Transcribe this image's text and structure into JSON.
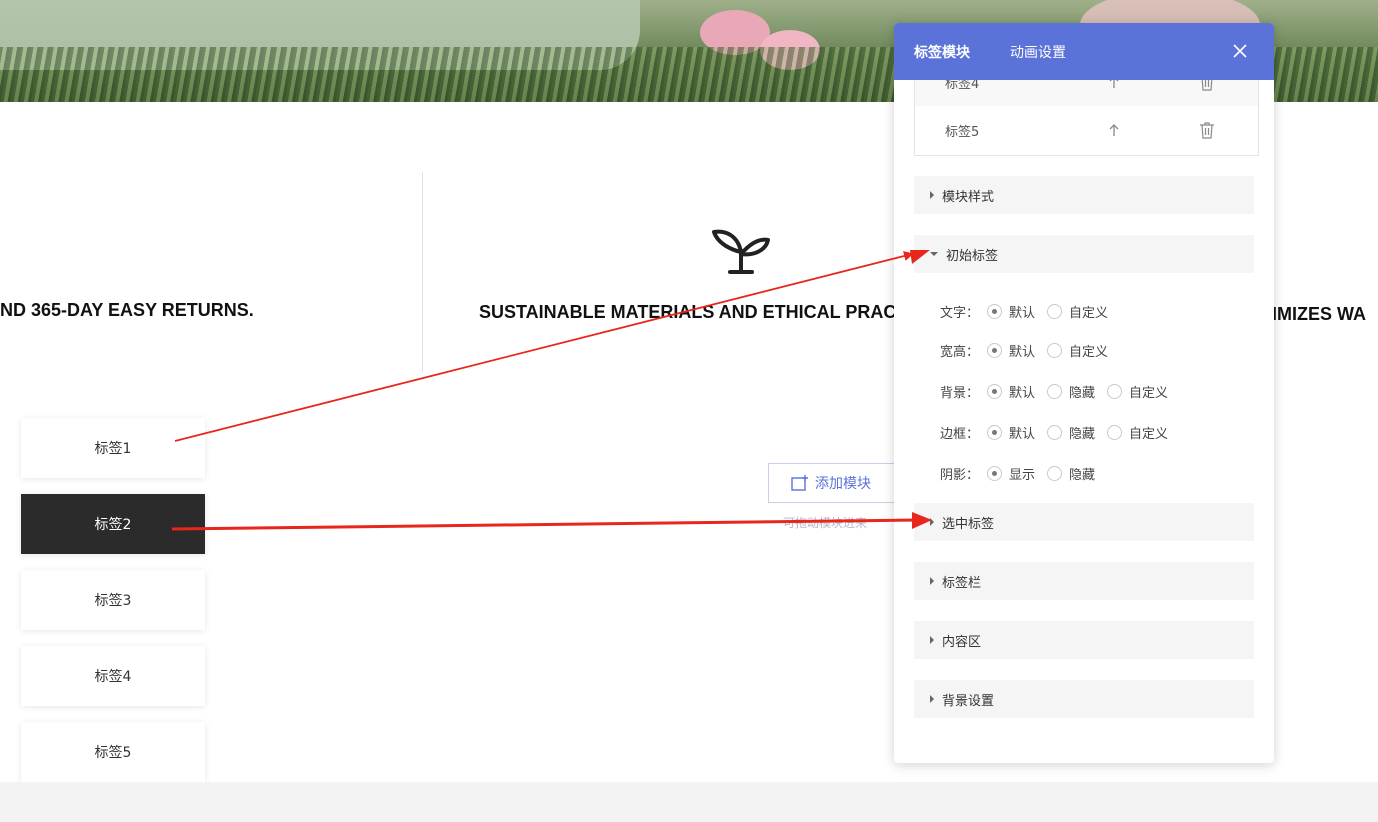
{
  "page": {
    "features": [
      {
        "text": "ND 365-DAY EASY RETURNS."
      },
      {
        "text": "SUSTAINABLE MATERIALS AND ETHICAL PRAC"
      },
      {
        "text": "IMIZES WA"
      }
    ],
    "tabs": [
      {
        "label": "标签1",
        "active": false
      },
      {
        "label": "标签2",
        "active": true
      },
      {
        "label": "标签3",
        "active": false
      },
      {
        "label": "标签4",
        "active": false
      },
      {
        "label": "标签5",
        "active": false
      }
    ],
    "add_module_label": "添加模块",
    "add_module_hint": "可拖动模块进来"
  },
  "panel": {
    "tabs": [
      {
        "label": "标签模块",
        "active": true
      },
      {
        "label": "动画设置",
        "active": false
      }
    ],
    "tag_list": [
      {
        "label": "标签4"
      },
      {
        "label": "标签5"
      }
    ],
    "sections": {
      "module_style": "模块样式",
      "initial_tag": "初始标签",
      "selected_tag": "选中标签",
      "tag_bar": "标签栏",
      "content_area": "内容区",
      "background": "背景设置"
    },
    "options": {
      "text": {
        "label": "文字：",
        "choices": [
          "默认",
          "自定义"
        ],
        "selected": "默认"
      },
      "size": {
        "label": "宽高：",
        "choices": [
          "默认",
          "自定义"
        ],
        "selected": "默认"
      },
      "bg": {
        "label": "背景：",
        "choices": [
          "默认",
          "隐藏",
          "自定义"
        ],
        "selected": "默认"
      },
      "border": {
        "label": "边框：",
        "choices": [
          "默认",
          "隐藏",
          "自定义"
        ],
        "selected": "默认"
      },
      "shadow": {
        "label": "阴影：",
        "choices": [
          "显示",
          "隐藏"
        ],
        "selected": "显示"
      }
    }
  },
  "colors": {
    "accent": "#5b73d8",
    "active_tab": "#2b2b2b",
    "annotation_arrow": "#e8261c"
  }
}
